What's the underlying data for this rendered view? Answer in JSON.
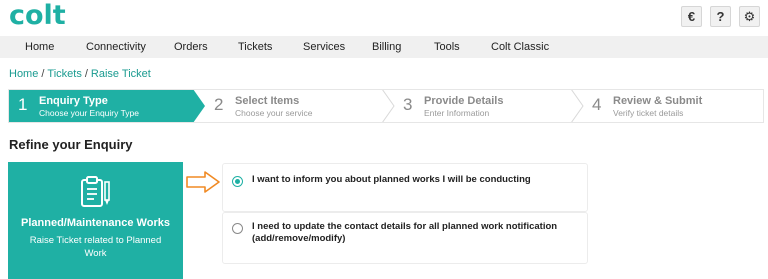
{
  "brand": {
    "logo_text": "colt",
    "accent": "#1fb0a4"
  },
  "top_icons": [
    {
      "name": "language-icon",
      "glyph": "€"
    },
    {
      "name": "help-icon",
      "glyph": "?"
    },
    {
      "name": "settings-icon",
      "glyph": "⚙"
    }
  ],
  "nav": {
    "items": [
      "Home",
      "Connectivity",
      "Orders",
      "Tickets",
      "Services",
      "Billing",
      "Tools",
      "Colt Classic"
    ]
  },
  "breadcrumb": {
    "items": [
      "Home",
      "Tickets",
      "Raise Ticket"
    ],
    "separator": "/"
  },
  "stepper": {
    "steps": [
      {
        "num": "1",
        "title": "Enquiry Type",
        "sub": "Choose your Enquiry Type",
        "active": true
      },
      {
        "num": "2",
        "title": "Select Items",
        "sub": "Choose your service",
        "active": false
      },
      {
        "num": "3",
        "title": "Provide Details",
        "sub": "Enter Information",
        "active": false
      },
      {
        "num": "4",
        "title": "Review & Submit",
        "sub": "Verify ticket details",
        "active": false
      }
    ]
  },
  "section": {
    "title": "Refine your Enquiry"
  },
  "card": {
    "title": "Planned/Maintenance Works",
    "subtitle": "Raise Ticket related to Planned Work",
    "icon": "clipboard-icon"
  },
  "options": [
    {
      "label": "I want to inform you about planned works I will be conducting",
      "selected": true
    },
    {
      "label": "I need to update the contact details for all planned work notification (add/remove/modify)",
      "selected": false
    }
  ],
  "colors": {
    "arrow": "#f08a24",
    "inactive_text": "#8a8a8a"
  }
}
